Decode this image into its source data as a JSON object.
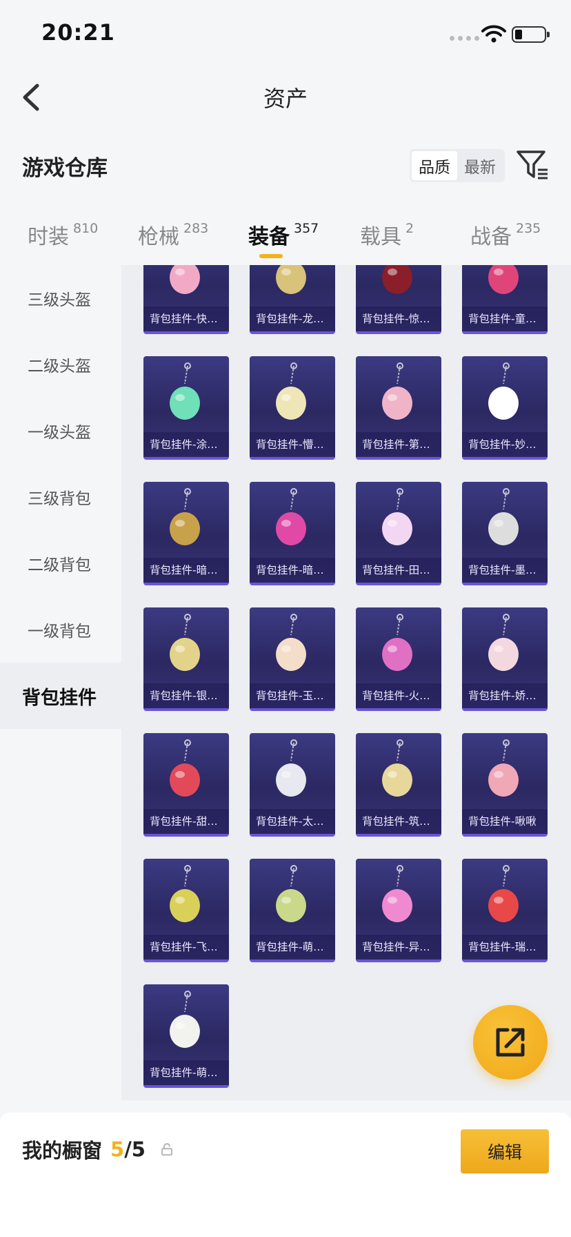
{
  "status_bar": {
    "time": "20:21"
  },
  "header": {
    "title": "资产"
  },
  "section": {
    "title": "游戏仓库",
    "sort_options": [
      "品质",
      "最新"
    ],
    "active_sort": 0
  },
  "tabs": [
    {
      "label": "时装",
      "count": "810"
    },
    {
      "label": "枪械",
      "count": "283"
    },
    {
      "label": "装备",
      "count": "357",
      "active": true
    },
    {
      "label": "载具",
      "count": "2"
    },
    {
      "label": "战备",
      "count": "235"
    }
  ],
  "sidebar": {
    "items": [
      {
        "label": "三级头盔"
      },
      {
        "label": "二级头盔"
      },
      {
        "label": "一级头盔"
      },
      {
        "label": "三级背包"
      },
      {
        "label": "二级背包"
      },
      {
        "label": "一级背包"
      },
      {
        "label": "背包挂件",
        "active": true
      }
    ]
  },
  "items": [
    {
      "name": "背包挂件-快…",
      "icon": "round-pink-charm",
      "color": "#f2a9c6"
    },
    {
      "name": "背包挂件-龙…",
      "icon": "lion-mask-charm",
      "color": "#d9c27a"
    },
    {
      "name": "背包挂件-惊…",
      "icon": "ring-tassel-charm",
      "color": "#8a1e2a"
    },
    {
      "name": "背包挂件-童…",
      "icon": "heart-spade-charm",
      "color": "#e0457a"
    },
    {
      "name": "背包挂件-涂…",
      "icon": "green-swirl-charm",
      "color": "#6fe0b8"
    },
    {
      "name": "背包挂件-懵…",
      "icon": "leaf-drop-charm",
      "color": "#efe6b8"
    },
    {
      "name": "背包挂件-第…",
      "icon": "heart-charm",
      "color": "#f0b4c8"
    },
    {
      "name": "背包挂件-妙…",
      "icon": "flower-charm",
      "color": "#ffffff"
    },
    {
      "name": "背包挂件-暗…",
      "icon": "dark-tassel-charm",
      "color": "#c8a24a"
    },
    {
      "name": "背包挂件-暗…",
      "icon": "dark-bird-charm",
      "color": "#e04aa6"
    },
    {
      "name": "背包挂件-田…",
      "icon": "photo-card-charm",
      "color": "#f3d6f2"
    },
    {
      "name": "背包挂件-墨…",
      "icon": "brush-charm",
      "color": "#dddddd"
    },
    {
      "name": "背包挂件-银…",
      "icon": "mouse-device-charm",
      "color": "#e3d38a"
    },
    {
      "name": "背包挂件-玉…",
      "icon": "rabbit-charm",
      "color": "#f4ddc9"
    },
    {
      "name": "背包挂件-火…",
      "icon": "rocket-charm",
      "color": "#e070c4"
    },
    {
      "name": "背包挂件-娇…",
      "icon": "cake-charm",
      "color": "#f3d8e0"
    },
    {
      "name": "背包挂件-甜…",
      "icon": "paw-charm",
      "color": "#e24a5a"
    },
    {
      "name": "背包挂件-太…",
      "icon": "astronaut-charm",
      "color": "#e8e8f0"
    },
    {
      "name": "背包挂件-筑…",
      "icon": "butterfly-charm",
      "color": "#e8d79a"
    },
    {
      "name": "背包挂件-啾啾",
      "icon": "pink-cat-charm",
      "color": "#f0a7b6"
    },
    {
      "name": "背包挂件-飞…",
      "icon": "winged-orb-charm",
      "color": "#d9d05a"
    },
    {
      "name": "背包挂件-萌…",
      "icon": "rice-dumpling-charm",
      "color": "#c9d889"
    },
    {
      "name": "背包挂件-异…",
      "icon": "roller-skate-charm",
      "color": "#f08ad0"
    },
    {
      "name": "背包挂件-瑞…",
      "icon": "lucky-knot-charm",
      "color": "#e94848"
    },
    {
      "name": "背包挂件-萌…",
      "icon": "sprout-blob-charm",
      "color": "#f2f2ee"
    }
  ],
  "showcase": {
    "label": "我的橱窗",
    "current": "5",
    "total": "/5"
  },
  "actions": {
    "edit_label": "编辑"
  },
  "colors": {
    "accent": "#f2b21c",
    "card_bg": "#2b2862",
    "card_border": "#6a55d8"
  }
}
